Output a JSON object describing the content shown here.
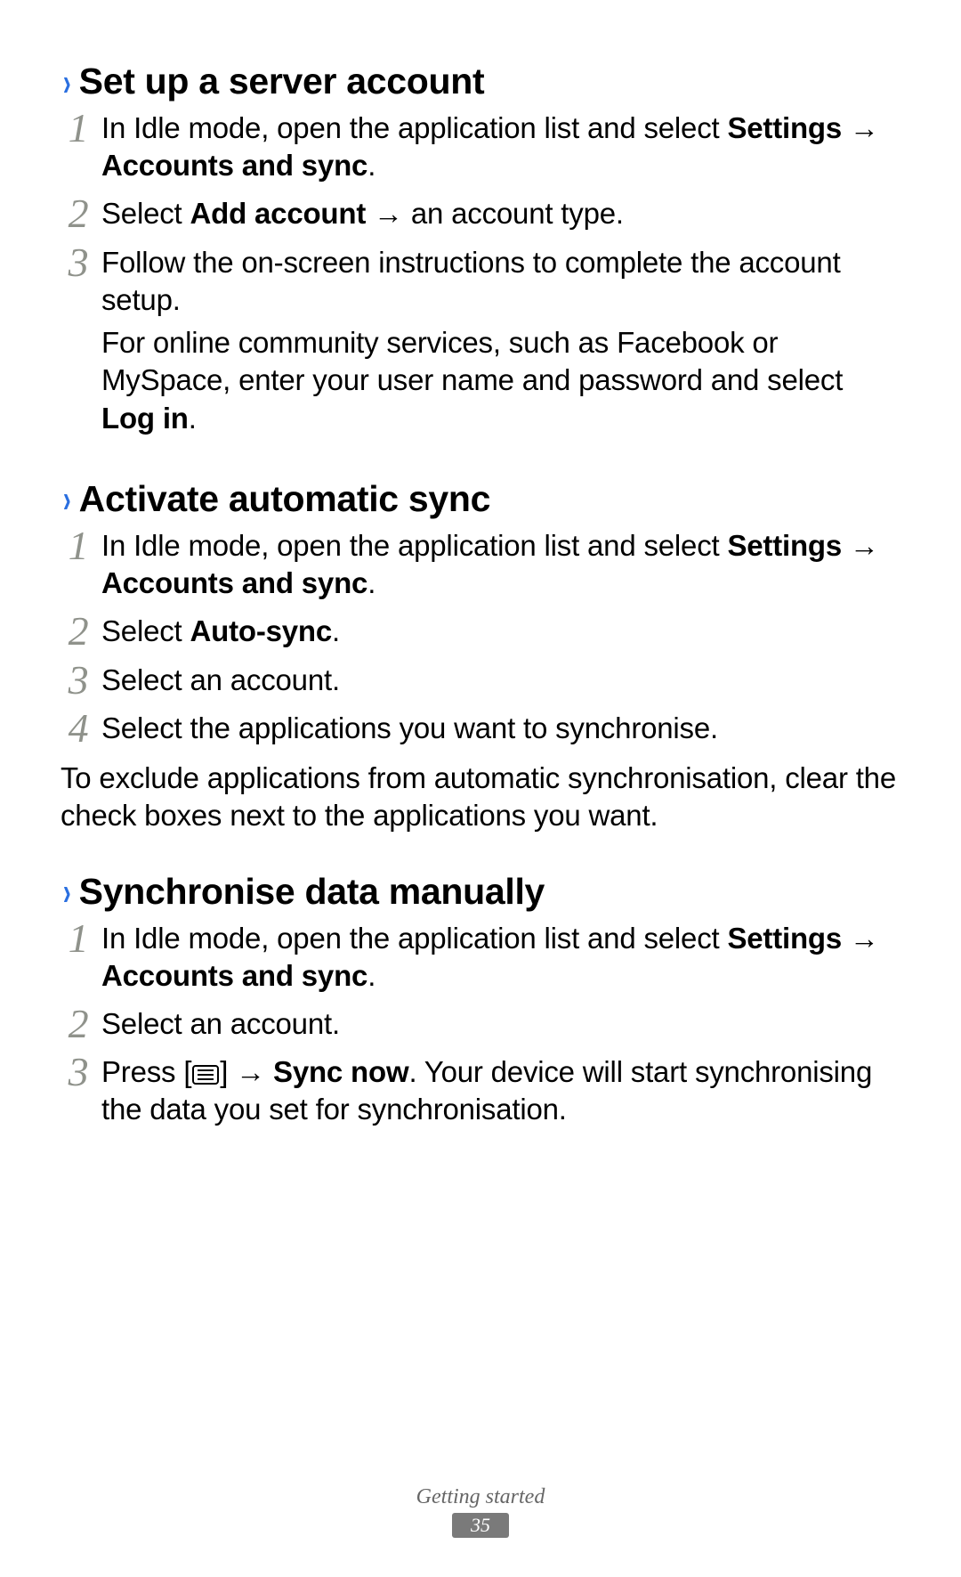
{
  "sections": [
    {
      "title": "Set up a server account",
      "steps": [
        {
          "parts": [
            {
              "t": "In Idle mode, open the application list and select "
            },
            {
              "t": "Settings",
              "b": true
            },
            {
              "t": " → "
            },
            {
              "t": "Accounts and sync",
              "b": true
            },
            {
              "t": "."
            }
          ]
        },
        {
          "parts": [
            {
              "t": "Select "
            },
            {
              "t": "Add account",
              "b": true
            },
            {
              "t": " → an account type."
            }
          ]
        },
        {
          "parts": [
            {
              "t": "Follow the on-screen instructions to complete the account setup."
            }
          ],
          "extra": [
            {
              "t": "For online community services, such as Facebook or MySpace, enter your user name and password and select "
            },
            {
              "t": "Log in",
              "b": true
            },
            {
              "t": "."
            }
          ]
        }
      ]
    },
    {
      "title": "Activate automatic sync",
      "steps": [
        {
          "parts": [
            {
              "t": "In Idle mode, open the application list and select "
            },
            {
              "t": "Settings",
              "b": true
            },
            {
              "t": " → "
            },
            {
              "t": "Accounts and sync",
              "b": true
            },
            {
              "t": "."
            }
          ]
        },
        {
          "parts": [
            {
              "t": "Select "
            },
            {
              "t": "Auto-sync",
              "b": true
            },
            {
              "t": "."
            }
          ]
        },
        {
          "parts": [
            {
              "t": "Select an account."
            }
          ]
        },
        {
          "parts": [
            {
              "t": "Select the applications you want to synchronise."
            }
          ]
        }
      ],
      "note": "To exclude applications from automatic synchronisation, clear the check boxes next to the applications you want."
    },
    {
      "title": "Synchronise data manually",
      "steps": [
        {
          "parts": [
            {
              "t": "In Idle mode, open the application list and select "
            },
            {
              "t": "Settings",
              "b": true
            },
            {
              "t": " → "
            },
            {
              "t": "Accounts and sync",
              "b": true
            },
            {
              "t": "."
            }
          ]
        },
        {
          "parts": [
            {
              "t": "Select an account."
            }
          ]
        },
        {
          "parts": [
            {
              "t": "Press ["
            },
            {
              "icon": "menu"
            },
            {
              "t": "] → "
            },
            {
              "t": "Sync now",
              "b": true
            },
            {
              "t": ". Your device will start synchronising the data you set for synchronisation."
            }
          ]
        }
      ]
    }
  ],
  "footer": {
    "chapter": "Getting started",
    "page": "35"
  }
}
